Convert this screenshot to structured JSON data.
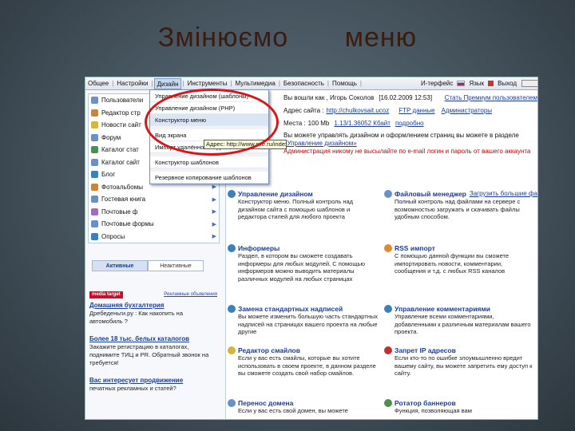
{
  "slide": {
    "title": "Змінюємо меню"
  },
  "menubar": {
    "items": [
      "Общее",
      "Настройки",
      "Дизайн",
      "Инструменты",
      "Мультимедиа",
      "Безопасность",
      "Помощь"
    ],
    "active_index": 2,
    "interface_label": "И-терфейс",
    "language_label": "Язык",
    "exit_label": "Выход"
  },
  "sidebar": {
    "items": [
      {
        "label": "Пользователи",
        "color": "#6a8fc9"
      },
      {
        "label": "Редактор стр",
        "color": "#c9853a"
      },
      {
        "label": "Новости сайт",
        "color": "#d2b73b"
      },
      {
        "label": "Форум",
        "color": "#6a8fc9"
      },
      {
        "label": "Каталог стат",
        "color": "#4d8f4d"
      },
      {
        "label": "Каталог сайт",
        "color": "#6a8fc9"
      },
      {
        "label": "Блог",
        "color": "#3b7fbd"
      },
      {
        "label": "Фотоальбомы",
        "color": "#c9853a"
      },
      {
        "label": "Гостевая книга",
        "color": "#6a8fc9"
      },
      {
        "label": "Почтовые ф",
        "color": "#a66bbf"
      },
      {
        "label": "Почтовые формы",
        "color": "#6a8fc9"
      },
      {
        "label": "Опросы",
        "color": "#3b7fbd"
      }
    ],
    "tabs": {
      "active": "Активные",
      "inactive": "Неактивные"
    },
    "ad_brand": "media target",
    "ad_link": "Рекламные объявления",
    "ads": [
      {
        "title": "Домашняя бухгалтерия",
        "desc": "Дребеденьги.ру : Как накопить на автомобиль ?"
      },
      {
        "title": "Более 18 тыс. белых каталогов",
        "desc": "Закажите регистрацию в каталогах, поднимите ТИЦ и PR. Обратный звонок на требуется!"
      },
      {
        "title": "Вас интересует продвижение",
        "desc": "печатных рекламных и статей?"
      }
    ]
  },
  "dropdown": {
    "items": [
      "Управление дизайном (шаблоны)",
      "Управление дизайном (PHP)",
      "Конструктор меню",
      "Вид экрана",
      "Импорт удалённого кода",
      "Конструктор шаблонов",
      "Резервное копирование шаблонов"
    ],
    "highlight_index": 2
  },
  "tooltip": {
    "text": "Адрес: http://www.site.ru/index/mainmenu"
  },
  "infobar": {
    "line1_left": "Вы вошли как , Игорь Соколов",
    "line1_date": "[16.02.2009 12:53]",
    "line1_right": "Стать Премиум пользователем",
    "line2_prefix": "Адрес сайта :",
    "line2_link": "http://chulkovsait.ucoz",
    "line2_ftp": "FTP данные",
    "line2_admins": "Администраторы",
    "line3_prefix": "Места :",
    "line3_value": "100 Mb",
    "line3_used": "1.13/1.36052 Кбайт",
    "line3_more": "подробно"
  },
  "notice": {
    "line1": "Вы можете управлять дизайном и оформлением страниц вы можете в разделе",
    "line2": "«Управление дизайном»",
    "warning": "Администрация никому не высылайте по e-mail логин и пароль от вашего аккаунта"
  },
  "modules": [
    {
      "title": "Управление дизайном",
      "sub": "",
      "color": "#3b7fbd",
      "desc": "Конструктор меню. Полный контроль над дизайном сайта с помощью шаблонов и редактора стилей для любого проекта"
    },
    {
      "title": "Файловый менеджер",
      "sub": "Загрузить большие файлы",
      "color": "#6a8fc9",
      "desc": "Полный контроль над файлами на сервере с возможностью загружать и скачивать файлы удобным способом."
    },
    {
      "title": "Информеры",
      "sub": "",
      "color": "#3b7fbd",
      "desc": "Раздел, в котором вы сможете создавать информеры для любых модулей. С помощью информеров можно выводить материалы различных модулей на любых страницах"
    },
    {
      "title": "RSS импорт",
      "sub": "",
      "color": "#e08a2a",
      "desc": "С помощью данной функции вы сможете импортировать новости, комментарии, сообщения и т.д. с любых RSS каналов"
    },
    {
      "title": "Замена стандартных надписей",
      "sub": "",
      "color": "#3b7fbd",
      "desc": "Вы можете изменить большую часть стандартных надписей на страницах вашего проекта на любые другие"
    },
    {
      "title": "Управление комментариями",
      "sub": "",
      "color": "#3b7fbd",
      "desc": "Управление всеми комментариями, добавленными к различным материалам вашего проекта."
    },
    {
      "title": "Редактор смайлов",
      "sub": "",
      "color": "#d2b73b",
      "desc": "Если у вас есть смайлы, которые вы хотите использовать в своем проекте, в данном разделе вы сможете создать свой набор смайлов."
    },
    {
      "title": "Запрет IP адресов",
      "sub": "",
      "color": "#c03030",
      "desc": "Если кто-то по ошибке злоумышленно вредит вашему сайту, вы можете запретить ему доступ к сайту."
    },
    {
      "title": "Перенос домена",
      "sub": "",
      "color": "#6a8fc9",
      "desc": "Если у вас есть свой домен, вы можете"
    },
    {
      "title": "Ротатор баннеров",
      "sub": "",
      "color": "#4d8f4d",
      "desc": "Функция, позволяющая вам"
    }
  ]
}
